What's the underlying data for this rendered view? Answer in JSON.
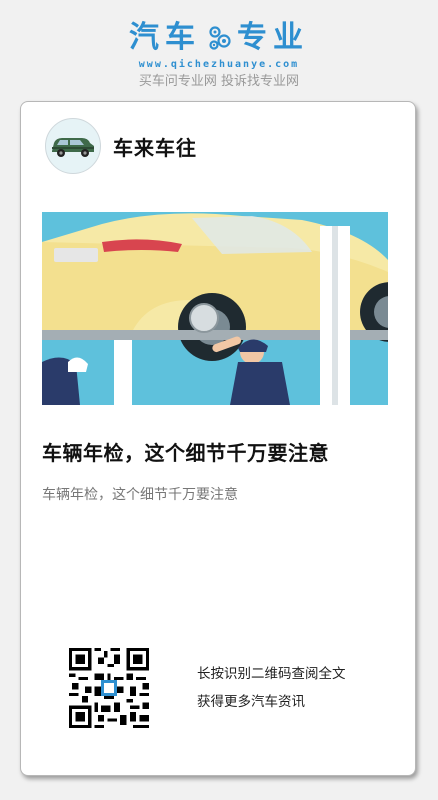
{
  "brand": {
    "title_left": "汽车",
    "title_right": "专业",
    "url": "www.qichezhuanye.com",
    "slogan": "买车问专业网 投诉找专业网",
    "color": "#2e8fd0"
  },
  "author": {
    "name": "车来车往",
    "avatar_icon": "green-car-icon"
  },
  "article": {
    "cover_icon": "car-inspection-illustration",
    "title": "车辆年检，这个细节千万要注意",
    "summary": "车辆年检，这个细节千万要注意"
  },
  "qr": {
    "icon": "qr-code-icon",
    "line1": "长按识别二维码查阅全文",
    "line2": "获得更多汽车资讯"
  }
}
